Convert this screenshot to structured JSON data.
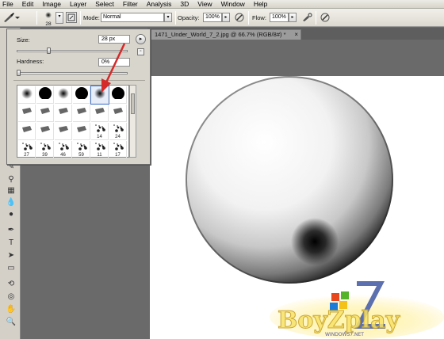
{
  "menu": [
    {
      "label": "File",
      "name": "menu-file"
    },
    {
      "label": "Edit",
      "name": "menu-edit"
    },
    {
      "label": "Image",
      "name": "menu-image"
    },
    {
      "label": "Layer",
      "name": "menu-layer"
    },
    {
      "label": "Select",
      "name": "menu-select"
    },
    {
      "label": "Filter",
      "name": "menu-filter"
    },
    {
      "label": "Analysis",
      "name": "menu-analysis"
    },
    {
      "label": "3D",
      "name": "menu-3d"
    },
    {
      "label": "View",
      "name": "menu-view"
    },
    {
      "label": "Window",
      "name": "menu-window"
    },
    {
      "label": "Help",
      "name": "menu-help"
    }
  ],
  "options": {
    "brush_size": "28",
    "mode_label": "Mode:",
    "mode_value": "Normal",
    "opacity_label": "Opacity:",
    "opacity_value": "100%",
    "flow_label": "Flow:",
    "flow_value": "100%"
  },
  "document_tab": {
    "title": "1471_Under_World_7_2.jpg @ 66.7% (RGB/8#) *",
    "close": "×"
  },
  "brush_panel": {
    "size_label": "Size:",
    "size_value": "28 px",
    "size_fraction": 0.28,
    "hardness_label": "Hardness:",
    "hardness_value": "0%",
    "hardness_fraction": 0.0,
    "presets": [
      {
        "kind": "soft",
        "num": ""
      },
      {
        "kind": "hard",
        "num": ""
      },
      {
        "kind": "soft",
        "num": ""
      },
      {
        "kind": "hard",
        "num": ""
      },
      {
        "kind": "soft",
        "num": "",
        "selected": true
      },
      {
        "kind": "hard",
        "num": ""
      },
      {
        "kind": "tip",
        "num": ""
      },
      {
        "kind": "tip",
        "num": ""
      },
      {
        "kind": "tip",
        "num": ""
      },
      {
        "kind": "tip",
        "num": ""
      },
      {
        "kind": "tip",
        "num": ""
      },
      {
        "kind": "tip",
        "num": ""
      },
      {
        "kind": "tip",
        "num": ""
      },
      {
        "kind": "tip",
        "num": ""
      },
      {
        "kind": "tip",
        "num": ""
      },
      {
        "kind": "tip",
        "num": ""
      },
      {
        "kind": "splat",
        "num": "14"
      },
      {
        "kind": "splat",
        "num": "24"
      },
      {
        "kind": "splat",
        "num": "27"
      },
      {
        "kind": "splat",
        "num": "39"
      },
      {
        "kind": "splat",
        "num": "46"
      },
      {
        "kind": "splat",
        "num": "59"
      },
      {
        "kind": "leaf",
        "num": "11"
      },
      {
        "kind": "splat",
        "num": "17"
      }
    ]
  },
  "watermark": {
    "brand": "BoyZplay",
    "subtext": "WINDOWS7.NET"
  },
  "colors": {
    "accent": "#d42a2a",
    "workspace": "#6a6a6a",
    "panel": "#d8d5cc"
  }
}
